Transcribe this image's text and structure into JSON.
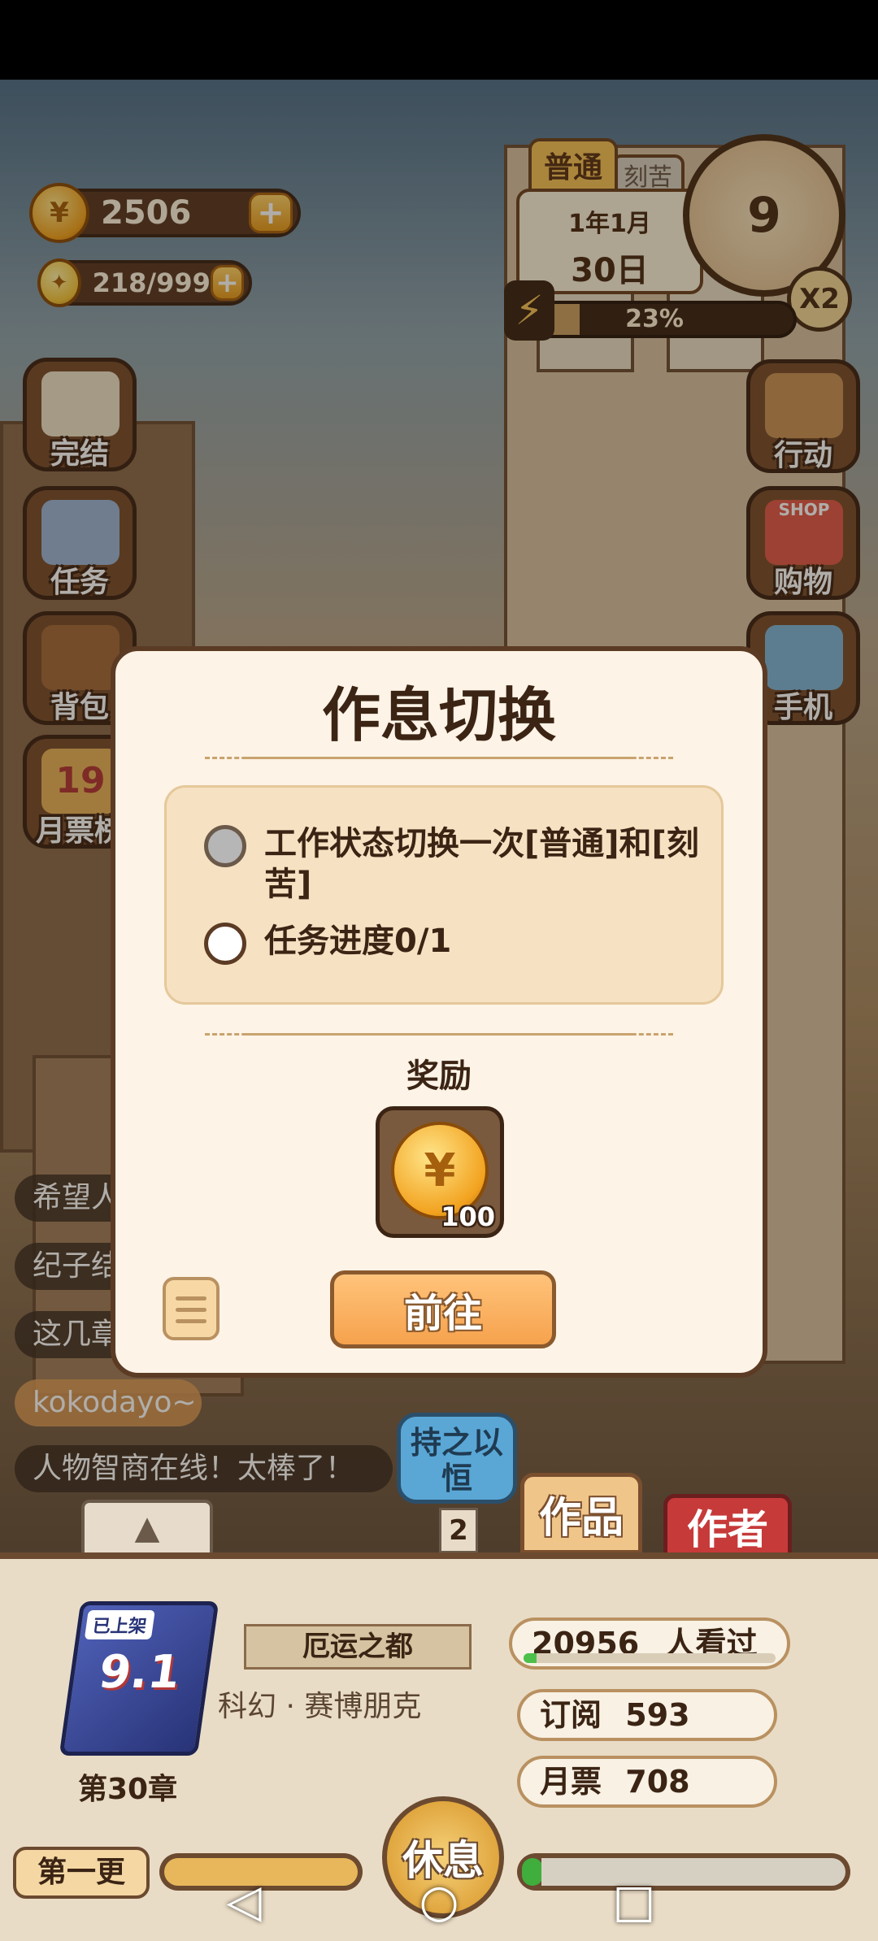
{
  "hud": {
    "coins": "2506",
    "inspiration": "218/999",
    "mode_active": "普通",
    "mode_other": "刻苦",
    "date_ym": "1年1月",
    "date_day": "30日",
    "clock_hour": "9",
    "speed": "X2",
    "energy_percent": "23%",
    "energy_value": 0.23
  },
  "left_menu": [
    {
      "label": "完结",
      "icon": "book-icon"
    },
    {
      "label": "任务",
      "icon": "clipboard-icon"
    },
    {
      "label": "背包",
      "icon": "backpack-icon"
    },
    {
      "label": "月票榜",
      "icon": "ticket-icon",
      "badge": "19"
    }
  ],
  "right_menu": [
    {
      "label": "行动",
      "icon": "door-icon"
    },
    {
      "label": "购物",
      "icon": "shop-icon",
      "badge": "SHOP"
    },
    {
      "label": "手机",
      "icon": "phone-icon"
    }
  ],
  "chat": [
    "希望人",
    "纪子结",
    "这几章",
    "kokodayo~",
    "人物智商在线！太棒了！"
  ],
  "modal": {
    "title": "作息切换",
    "tasks": [
      {
        "text": "工作状态切换一次[普通]和[刻苦]",
        "done": true
      },
      {
        "text": "任务进度0/1",
        "done": false
      }
    ],
    "reward_label": "奖励",
    "reward_count": "100",
    "go_button": "前往"
  },
  "bottom": {
    "persist_badge": "持之以恒",
    "persist_count": "2",
    "tab_works": "作品",
    "tab_author": "作者",
    "book_tag": "已上架",
    "book_score": "9.1",
    "book_title": "厄运之都",
    "book_genre": "科幻 · 赛博朋克",
    "chapter": "第30章",
    "views_value": "20956",
    "views_label": "人看过",
    "views_progress": 0.05,
    "subscribe_label": "订阅",
    "subscribe_value": "593",
    "monthly_label": "月票",
    "monthly_value": "708",
    "update_button": "第一更",
    "rest_button": "休息"
  },
  "navbar": {
    "back": "◁",
    "home": "○",
    "recent": "□"
  }
}
